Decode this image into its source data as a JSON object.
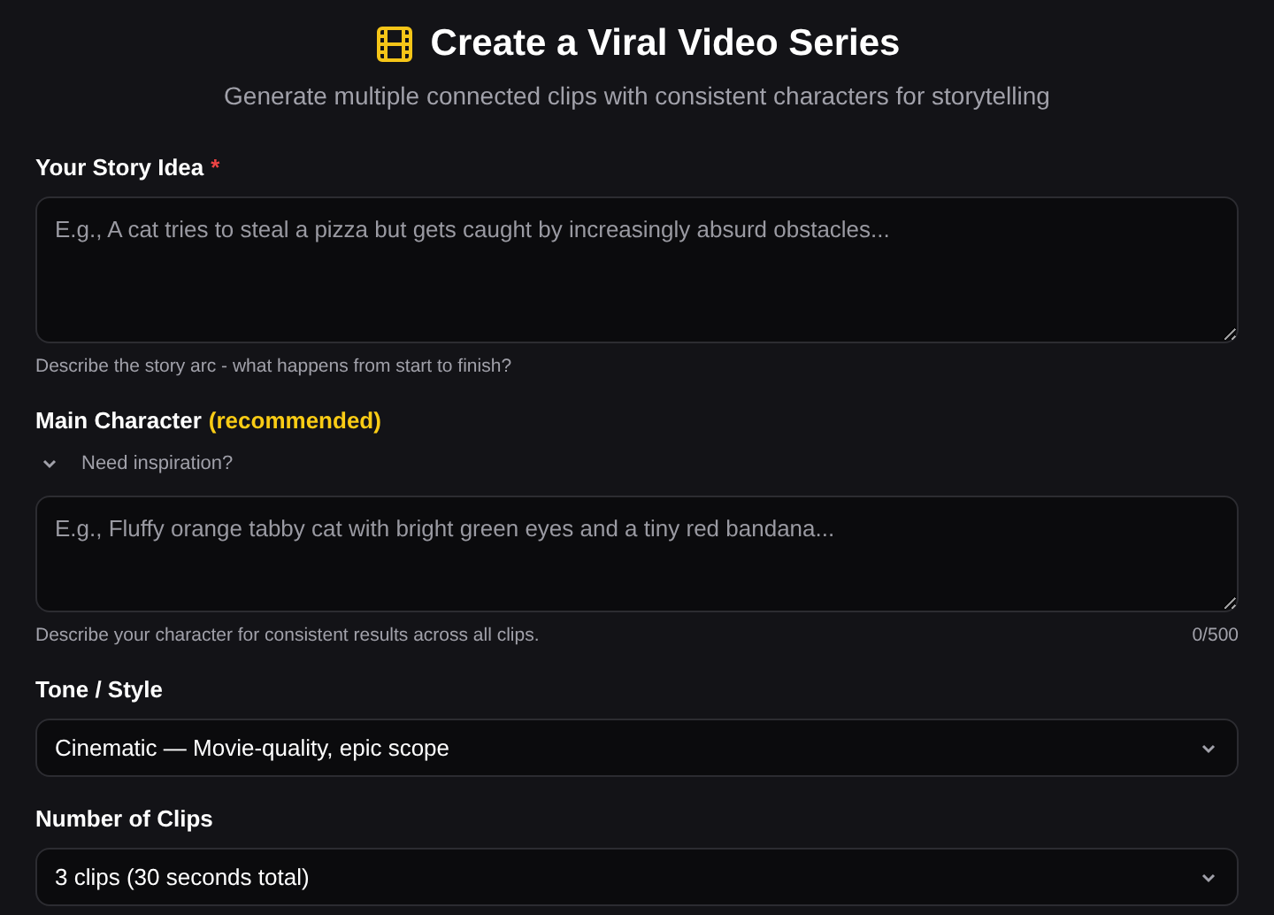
{
  "header": {
    "title": "Create a Viral Video Series",
    "subtitle": "Generate multiple connected clips with consistent characters for storytelling"
  },
  "fields": [
    {
      "kind": "textarea",
      "label": "Your Story Idea",
      "required_mark": "*",
      "placeholder": "E.g., A cat tries to steal a pizza but gets caught by increasingly absurd obstacles...",
      "hint": "Describe the story arc - what happens from start to finish?"
    },
    {
      "kind": "textarea",
      "label": "Main Character",
      "label_note": "(recommended)",
      "toggle": {
        "label": "Need inspiration?",
        "expanded": false
      },
      "placeholder": "E.g., Fluffy orange tabby cat with bright green eyes and a tiny red bandana...",
      "hint": "Describe your character for consistent results across all clips.",
      "counter": "0/500"
    },
    {
      "kind": "select",
      "label": "Tone / Style",
      "value": "Cinematic — Movie-quality, epic scope"
    },
    {
      "kind": "select",
      "label": "Number of Clips",
      "value": "3 clips (30 seconds total)"
    }
  ]
}
